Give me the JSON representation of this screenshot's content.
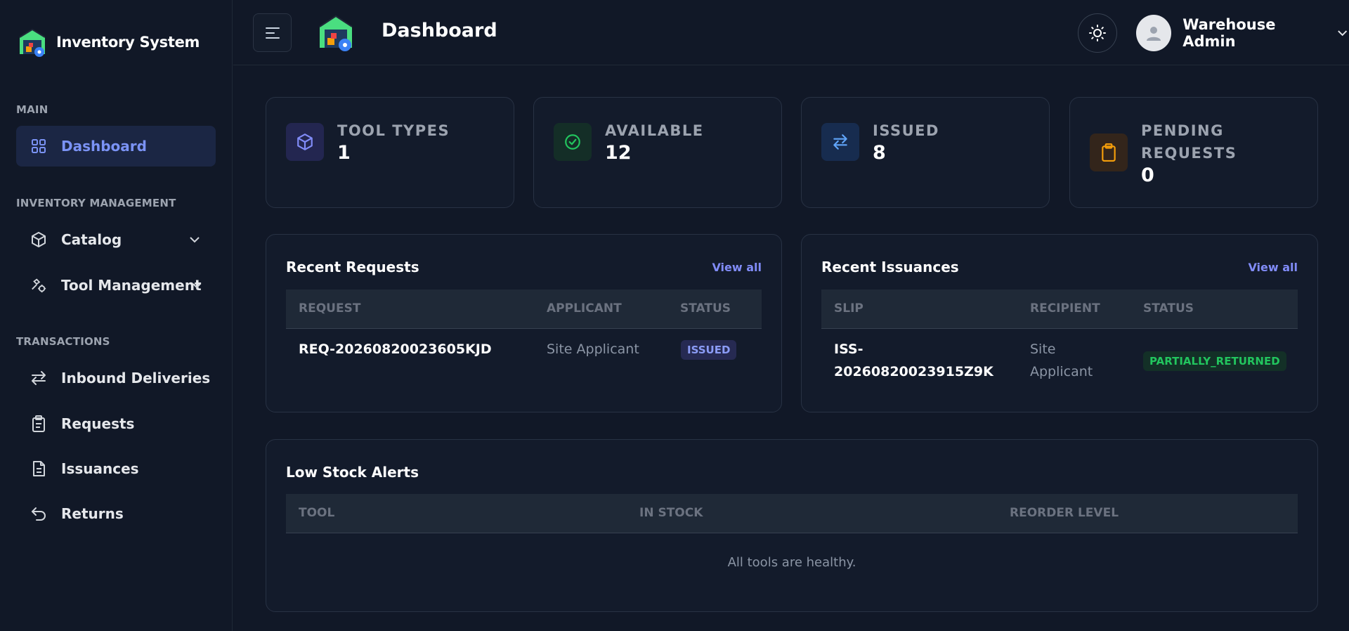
{
  "brand": {
    "name": "Inventory System"
  },
  "sidebar": {
    "sections": [
      {
        "label": "MAIN"
      },
      {
        "label": "INVENTORY MANAGEMENT"
      },
      {
        "label": "TRANSACTIONS"
      }
    ],
    "items": [
      {
        "label": "Dashboard",
        "icon": "grid-icon",
        "active": true
      },
      {
        "label": "Catalog",
        "icon": "cube-icon",
        "has_children": true
      },
      {
        "label": "Tool Management",
        "icon": "tools-icon",
        "has_children": true
      },
      {
        "label": "Inbound Deliveries",
        "icon": "arrows-exchange-icon"
      },
      {
        "label": "Requests",
        "icon": "clipboard-list-icon"
      },
      {
        "label": "Issuances",
        "icon": "document-icon"
      },
      {
        "label": "Returns",
        "icon": "return-arrow-icon"
      }
    ]
  },
  "header": {
    "title": "Dashboard",
    "user_name": "Warehouse Admin"
  },
  "stats": [
    {
      "label": "TOOL TYPES",
      "value": "1",
      "icon": "cube-icon",
      "color": "#818cf8"
    },
    {
      "label": "AVAILABLE",
      "value": "12",
      "icon": "check-circle-icon",
      "color": "#22c55e"
    },
    {
      "label": "ISSUED",
      "value": "8",
      "icon": "arrows-exchange-icon",
      "color": "#60a5fa"
    },
    {
      "label": "PENDING REQUESTS",
      "value": "0",
      "icon": "clipboard-icon",
      "color": "#f59e0b"
    }
  ],
  "recent_requests": {
    "title": "Recent Requests",
    "view_all": "View all",
    "columns": [
      "REQUEST",
      "APPLICANT",
      "STATUS"
    ],
    "rows": [
      {
        "request": "REQ-20260820023605KJD",
        "applicant": "Site Applicant",
        "status": "ISSUED"
      }
    ]
  },
  "recent_issuances": {
    "title": "Recent Issuances",
    "view_all": "View all",
    "columns": [
      "SLIP",
      "RECIPIENT",
      "STATUS"
    ],
    "rows": [
      {
        "slip_line1": "ISS-",
        "slip_line2": "20260820023915Z9K",
        "recipient_line1": "Site",
        "recipient_line2": "Applicant",
        "status": "PARTIALLY_RETURNED"
      }
    ]
  },
  "low_stock": {
    "title": "Low Stock Alerts",
    "columns": [
      "TOOL",
      "IN STOCK",
      "REORDER LEVEL"
    ],
    "empty_message": "All tools are healthy."
  },
  "colors": {
    "background": "#111827",
    "card": "#131b2b",
    "accent": "#818cf8",
    "active_nav": "#1b2644"
  }
}
